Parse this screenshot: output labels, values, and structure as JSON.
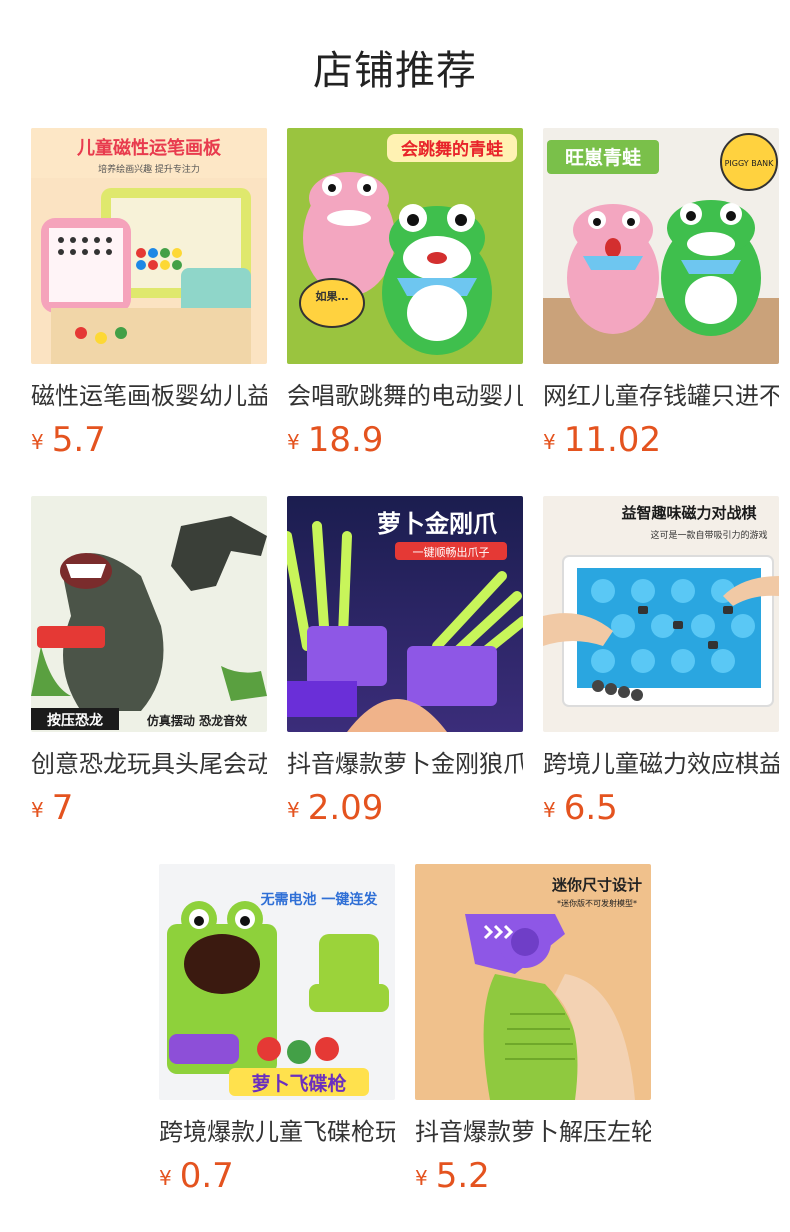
{
  "header": {
    "title": "店铺推荐"
  },
  "currency": "¥",
  "products": [
    {
      "name": "磁性运笔画板婴幼儿益智",
      "price": "5.7",
      "image_caption": "儿童磁性运笔画板",
      "image_sub": "培养绘画兴趣  提升专注力"
    },
    {
      "name": "会唱歌跳舞的电动婴儿玩具",
      "price": "18.9",
      "image_caption": "会跳舞的青蛙",
      "image_sub": "如果…"
    },
    {
      "name": "网红儿童存钱罐只进不出",
      "price": "11.02",
      "image_caption": "旺崽青蛙",
      "image_sub": "PIGGY BANK"
    },
    {
      "name": "创意恐龙玩具头尾会动",
      "price": "7",
      "image_caption": "按压恐龙",
      "image_sub": "仿真摆动 恐龙音效"
    },
    {
      "name": "抖音爆款萝卜金刚狼爪子",
      "price": "2.09",
      "image_caption": "萝卜金刚爪",
      "image_sub": "一键顺畅出爪子"
    },
    {
      "name": "跨境儿童磁力效应棋益智",
      "price": "6.5",
      "image_caption": "益智趣味磁力对战棋",
      "image_sub": "这可是一款自带吸引力的游戏"
    },
    {
      "name": "跨境爆款儿童飞碟枪玩具",
      "price": "0.7",
      "image_caption": "萝卜飞碟枪",
      "image_sub": "无需电池 一键连发"
    },
    {
      "name": "抖音爆款萝卜解压左轮枪",
      "price": "5.2",
      "image_caption": "迷你尺寸设计",
      "image_sub": "*迷你版不可发射模型*"
    }
  ]
}
